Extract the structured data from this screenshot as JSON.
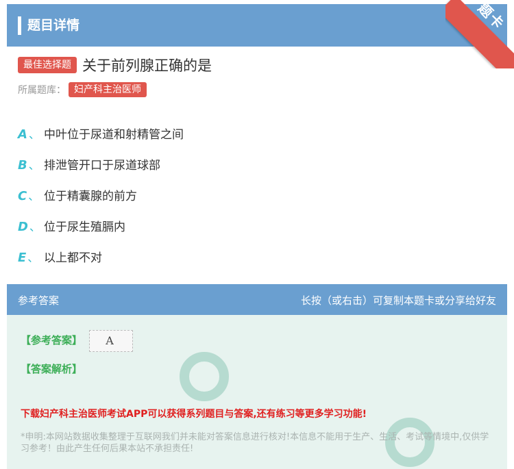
{
  "header": {
    "title": "题目详情",
    "ribbon": "题卡"
  },
  "question": {
    "type_badge": "最佳选择题",
    "title": "关于前列腺正确的是",
    "bank_label": "所属题库：",
    "bank_name": "妇产科主治医师"
  },
  "options": [
    {
      "letter": "A",
      "sep": "、",
      "text": "中叶位于尿道和射精管之间"
    },
    {
      "letter": "B",
      "sep": "、",
      "text": "排泄管开口于尿道球部"
    },
    {
      "letter": "C",
      "sep": "、",
      "text": "位于精囊腺的前方"
    },
    {
      "letter": "D",
      "sep": "、",
      "text": "位于尿生殖膈内"
    },
    {
      "letter": "E",
      "sep": "、",
      "text": "以上都不对"
    }
  ],
  "answer_section": {
    "title": "参考答案",
    "hint": "长按（或右击）可复制本题卡或分享给好友",
    "answer_label": "【参考答案】",
    "answer_value": "A",
    "analysis_label": "【答案解析】",
    "promo": "下载妇产科主治医师考试APP可以获得系列题目与答案,还有练习等更多学习功能!",
    "disclaimer": "*申明:本网站数据收集整理于互联网我们并未能对答案信息进行核对!本信息不能用于生产、生活、考试等情境中,仅供学习参考！由此产生任何后果本站不承担责任!"
  },
  "colors": {
    "header_bg": "#6a9fd0",
    "accent_red": "#e0564d",
    "option_letter": "#3bbfd1",
    "answer_green": "#3cae57"
  }
}
